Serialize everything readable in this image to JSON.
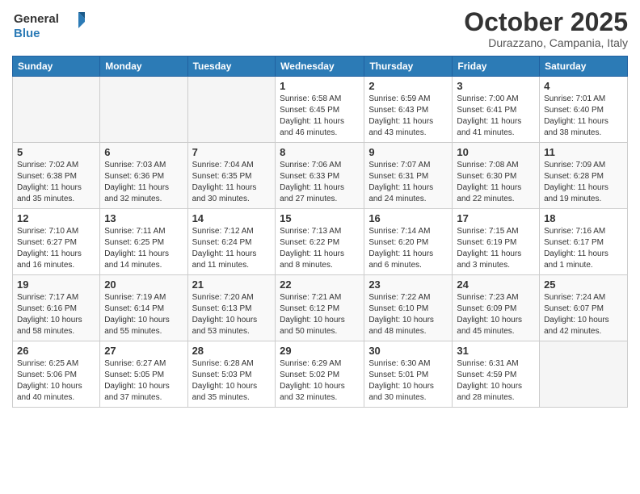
{
  "logo": {
    "line1": "General",
    "line2": "Blue"
  },
  "title": "October 2025",
  "location": "Durazzano, Campania, Italy",
  "headers": [
    "Sunday",
    "Monday",
    "Tuesday",
    "Wednesday",
    "Thursday",
    "Friday",
    "Saturday"
  ],
  "weeks": [
    [
      {
        "day": "",
        "info": ""
      },
      {
        "day": "",
        "info": ""
      },
      {
        "day": "",
        "info": ""
      },
      {
        "day": "1",
        "info": "Sunrise: 6:58 AM\nSunset: 6:45 PM\nDaylight: 11 hours\nand 46 minutes."
      },
      {
        "day": "2",
        "info": "Sunrise: 6:59 AM\nSunset: 6:43 PM\nDaylight: 11 hours\nand 43 minutes."
      },
      {
        "day": "3",
        "info": "Sunrise: 7:00 AM\nSunset: 6:41 PM\nDaylight: 11 hours\nand 41 minutes."
      },
      {
        "day": "4",
        "info": "Sunrise: 7:01 AM\nSunset: 6:40 PM\nDaylight: 11 hours\nand 38 minutes."
      }
    ],
    [
      {
        "day": "5",
        "info": "Sunrise: 7:02 AM\nSunset: 6:38 PM\nDaylight: 11 hours\nand 35 minutes."
      },
      {
        "day": "6",
        "info": "Sunrise: 7:03 AM\nSunset: 6:36 PM\nDaylight: 11 hours\nand 32 minutes."
      },
      {
        "day": "7",
        "info": "Sunrise: 7:04 AM\nSunset: 6:35 PM\nDaylight: 11 hours\nand 30 minutes."
      },
      {
        "day": "8",
        "info": "Sunrise: 7:06 AM\nSunset: 6:33 PM\nDaylight: 11 hours\nand 27 minutes."
      },
      {
        "day": "9",
        "info": "Sunrise: 7:07 AM\nSunset: 6:31 PM\nDaylight: 11 hours\nand 24 minutes."
      },
      {
        "day": "10",
        "info": "Sunrise: 7:08 AM\nSunset: 6:30 PM\nDaylight: 11 hours\nand 22 minutes."
      },
      {
        "day": "11",
        "info": "Sunrise: 7:09 AM\nSunset: 6:28 PM\nDaylight: 11 hours\nand 19 minutes."
      }
    ],
    [
      {
        "day": "12",
        "info": "Sunrise: 7:10 AM\nSunset: 6:27 PM\nDaylight: 11 hours\nand 16 minutes."
      },
      {
        "day": "13",
        "info": "Sunrise: 7:11 AM\nSunset: 6:25 PM\nDaylight: 11 hours\nand 14 minutes."
      },
      {
        "day": "14",
        "info": "Sunrise: 7:12 AM\nSunset: 6:24 PM\nDaylight: 11 hours\nand 11 minutes."
      },
      {
        "day": "15",
        "info": "Sunrise: 7:13 AM\nSunset: 6:22 PM\nDaylight: 11 hours\nand 8 minutes."
      },
      {
        "day": "16",
        "info": "Sunrise: 7:14 AM\nSunset: 6:20 PM\nDaylight: 11 hours\nand 6 minutes."
      },
      {
        "day": "17",
        "info": "Sunrise: 7:15 AM\nSunset: 6:19 PM\nDaylight: 11 hours\nand 3 minutes."
      },
      {
        "day": "18",
        "info": "Sunrise: 7:16 AM\nSunset: 6:17 PM\nDaylight: 11 hours\nand 1 minute."
      }
    ],
    [
      {
        "day": "19",
        "info": "Sunrise: 7:17 AM\nSunset: 6:16 PM\nDaylight: 10 hours\nand 58 minutes."
      },
      {
        "day": "20",
        "info": "Sunrise: 7:19 AM\nSunset: 6:14 PM\nDaylight: 10 hours\nand 55 minutes."
      },
      {
        "day": "21",
        "info": "Sunrise: 7:20 AM\nSunset: 6:13 PM\nDaylight: 10 hours\nand 53 minutes."
      },
      {
        "day": "22",
        "info": "Sunrise: 7:21 AM\nSunset: 6:12 PM\nDaylight: 10 hours\nand 50 minutes."
      },
      {
        "day": "23",
        "info": "Sunrise: 7:22 AM\nSunset: 6:10 PM\nDaylight: 10 hours\nand 48 minutes."
      },
      {
        "day": "24",
        "info": "Sunrise: 7:23 AM\nSunset: 6:09 PM\nDaylight: 10 hours\nand 45 minutes."
      },
      {
        "day": "25",
        "info": "Sunrise: 7:24 AM\nSunset: 6:07 PM\nDaylight: 10 hours\nand 42 minutes."
      }
    ],
    [
      {
        "day": "26",
        "info": "Sunrise: 6:25 AM\nSunset: 5:06 PM\nDaylight: 10 hours\nand 40 minutes."
      },
      {
        "day": "27",
        "info": "Sunrise: 6:27 AM\nSunset: 5:05 PM\nDaylight: 10 hours\nand 37 minutes."
      },
      {
        "day": "28",
        "info": "Sunrise: 6:28 AM\nSunset: 5:03 PM\nDaylight: 10 hours\nand 35 minutes."
      },
      {
        "day": "29",
        "info": "Sunrise: 6:29 AM\nSunset: 5:02 PM\nDaylight: 10 hours\nand 32 minutes."
      },
      {
        "day": "30",
        "info": "Sunrise: 6:30 AM\nSunset: 5:01 PM\nDaylight: 10 hours\nand 30 minutes."
      },
      {
        "day": "31",
        "info": "Sunrise: 6:31 AM\nSunset: 4:59 PM\nDaylight: 10 hours\nand 28 minutes."
      },
      {
        "day": "",
        "info": ""
      }
    ]
  ]
}
